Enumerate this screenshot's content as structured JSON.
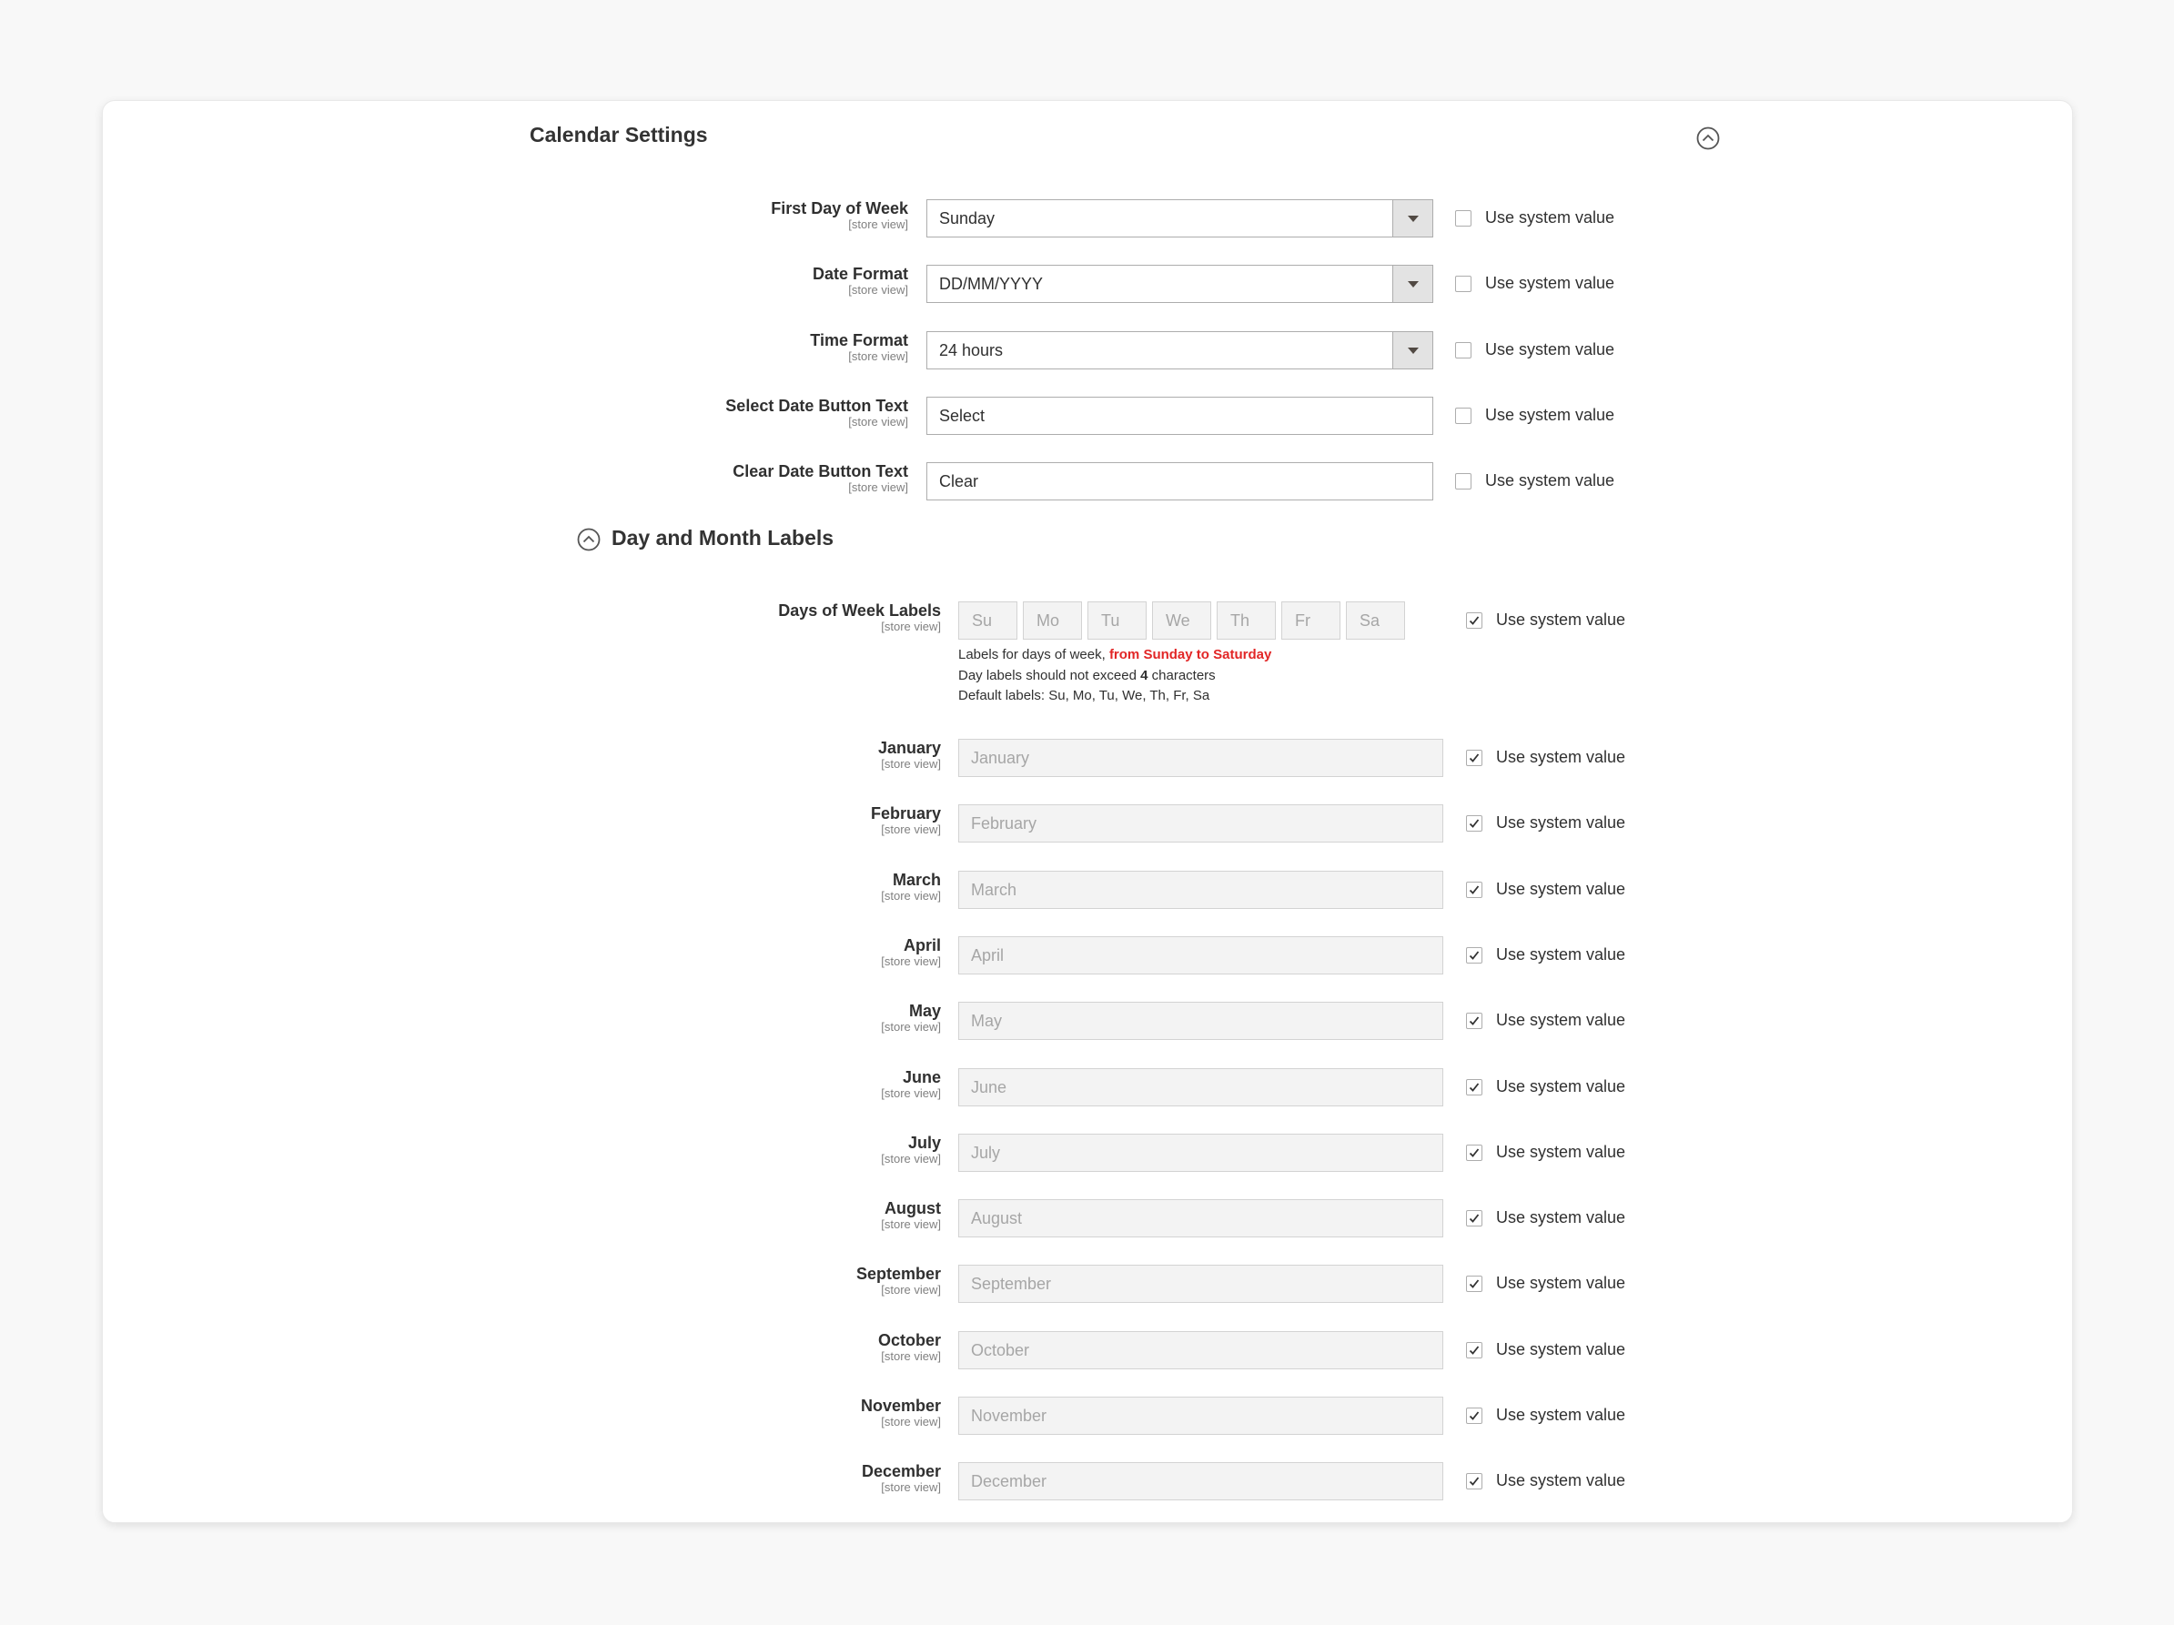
{
  "section": {
    "title": "Calendar Settings"
  },
  "subsection": {
    "title": "Day and Month Labels"
  },
  "use_system_label": "Use system value",
  "general_fields": [
    {
      "label": "First Day of Week",
      "scope": "[store view]",
      "type": "select",
      "value": "Sunday",
      "use_system": false
    },
    {
      "label": "Date Format",
      "scope": "[store view]",
      "type": "select",
      "value": "DD/MM/YYYY",
      "use_system": false
    },
    {
      "label": "Time Format",
      "scope": "[store view]",
      "type": "select",
      "value": "24 hours",
      "use_system": false
    },
    {
      "label": "Select Date Button Text",
      "scope": "[store view]",
      "type": "text",
      "value": "Select",
      "use_system": false
    },
    {
      "label": "Clear Date Button Text",
      "scope": "[store view]",
      "type": "text",
      "value": "Clear",
      "use_system": false
    }
  ],
  "days_of_week": {
    "label": "Days of Week Labels",
    "scope": "[store view]",
    "placeholders": [
      "Su",
      "Mo",
      "Tu",
      "We",
      "Th",
      "Fr",
      "Sa"
    ],
    "use_system": true,
    "note_line1_prefix": "Labels for days of week, ",
    "note_line1_highlight": "from Sunday to Saturday",
    "note_line2_prefix": "Day labels should not exceed ",
    "note_line2_number": "4",
    "note_line2_suffix": " characters",
    "note_line3": "Default labels: Su, Mo, Tu, We, Th, Fr, Sa"
  },
  "months": [
    {
      "label": "January",
      "scope": "[store view]",
      "placeholder": "January",
      "use_system": true
    },
    {
      "label": "February",
      "scope": "[store view]",
      "placeholder": "February",
      "use_system": true
    },
    {
      "label": "March",
      "scope": "[store view]",
      "placeholder": "March",
      "use_system": true
    },
    {
      "label": "April",
      "scope": "[store view]",
      "placeholder": "April",
      "use_system": true
    },
    {
      "label": "May",
      "scope": "[store view]",
      "placeholder": "May",
      "use_system": true
    },
    {
      "label": "June",
      "scope": "[store view]",
      "placeholder": "June",
      "use_system": true
    },
    {
      "label": "July",
      "scope": "[store view]",
      "placeholder": "July",
      "use_system": true
    },
    {
      "label": "August",
      "scope": "[store view]",
      "placeholder": "August",
      "use_system": true
    },
    {
      "label": "September",
      "scope": "[store view]",
      "placeholder": "September",
      "use_system": true
    },
    {
      "label": "October",
      "scope": "[store view]",
      "placeholder": "October",
      "use_system": true
    },
    {
      "label": "November",
      "scope": "[store view]",
      "placeholder": "November",
      "use_system": true
    },
    {
      "label": "December",
      "scope": "[store view]",
      "placeholder": "December",
      "use_system": true
    }
  ],
  "icons": {
    "collapse": "chevron-up-circle-icon",
    "dropdown": "chevron-down-icon",
    "check": "checkmark-icon"
  }
}
